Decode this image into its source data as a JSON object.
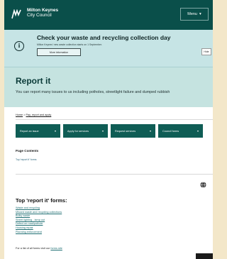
{
  "header": {
    "org_line1": "Milton Keynes",
    "org_line2": "City Council",
    "menu_label": "Menu",
    "menu_icon": "chevron-down-icon"
  },
  "alert": {
    "title": "Check your waste and recycling collection day",
    "subtitle": "Milton Keynes' new waste collection starts on 1 September.",
    "button_label": "More information",
    "hide_label": "Hide",
    "icon": "info-icon"
  },
  "hero": {
    "title": "Report it",
    "description": "You can report many issues to us including potholes, streetlight failure and dumped rubbish"
  },
  "breadcrumb": {
    "home": "Home",
    "separator": ">",
    "current": "Pay, report and apply"
  },
  "service_buttons": [
    {
      "label": "Report an issue"
    },
    {
      "label": "Apply for services"
    },
    {
      "label": "Request services"
    },
    {
      "label": "Council forms"
    }
  ],
  "page_contents": {
    "heading": "Page Contents",
    "link": "Top 'report it' forms"
  },
  "forms": {
    "heading": "Top 'report it' forms:",
    "items": [
      "Waste and recycling",
      "Missed waste and recycling collections",
      "Bulky waste",
      "Street lighting - lamp out",
      "Defect on road/pothole",
      "Housing repair",
      "Planning enforcement"
    ],
    "footer_prefix": "For a list of all forms visit our",
    "footer_link": "forms site"
  },
  "colors": {
    "header_bg": "#0a4f4a",
    "alert_bg": "#c6e4e5",
    "hero_bg": "#c5e3e0",
    "button_bg": "#0f5d55",
    "link": "#1f6f73"
  }
}
